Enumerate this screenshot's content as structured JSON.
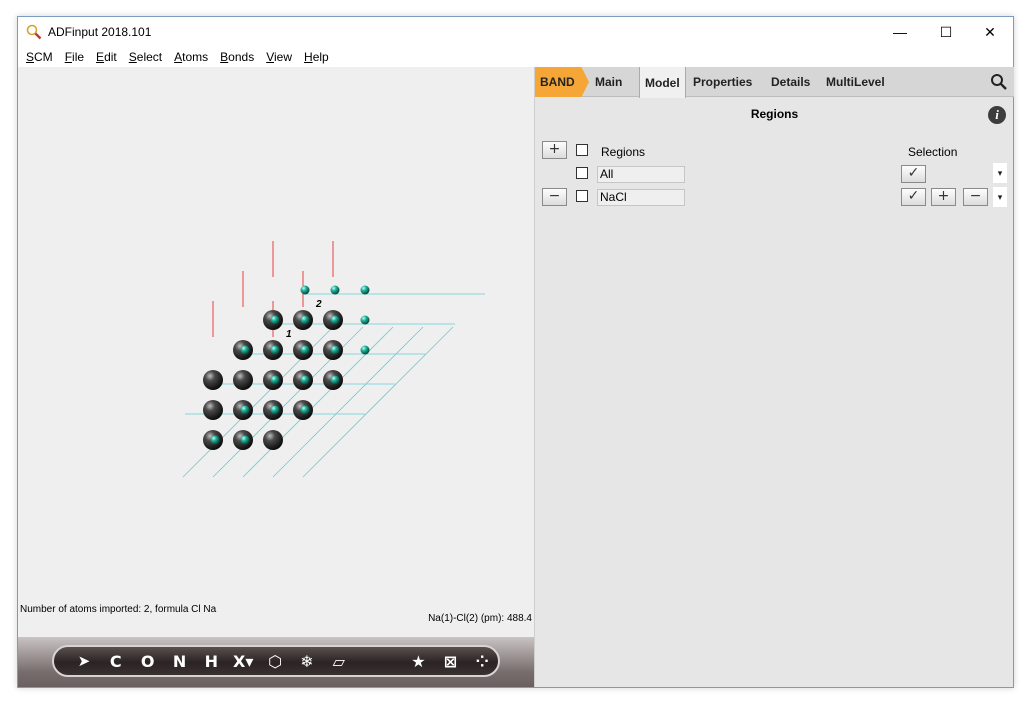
{
  "window": {
    "title": "ADFinput 2018.101",
    "controls": {
      "minimize": "—",
      "maximize": "☐",
      "close": "✕"
    }
  },
  "menu": [
    "SCM",
    "File",
    "Edit",
    "Select",
    "Atoms",
    "Bonds",
    "View",
    "Help"
  ],
  "viewer": {
    "status_left": "Number of atoms imported: 2, formula Cl Na",
    "status_right": "Na(1)-Cl(2) (pm): 488.4",
    "atom_labels": [
      "1",
      "2"
    ],
    "colors": {
      "na_atom": "#2a2a2a",
      "cl_atom": "#1fb39a",
      "cell_lines": "#63cfd6",
      "bond_red": "#e84040"
    }
  },
  "toolbar": {
    "items": [
      {
        "name": "select-tool",
        "glyph": "➤"
      },
      {
        "name": "carbon-tool",
        "glyph": "C"
      },
      {
        "name": "oxygen-tool",
        "glyph": "O"
      },
      {
        "name": "nitrogen-tool",
        "glyph": "N"
      },
      {
        "name": "hydrogen-tool",
        "glyph": "H"
      },
      {
        "name": "other-element-tool",
        "glyph": "X▾"
      },
      {
        "name": "ring-tool",
        "glyph": "⬡"
      },
      {
        "name": "snowflake-tool",
        "glyph": "❄"
      },
      {
        "name": "plane-tool",
        "glyph": "▱"
      },
      {
        "name": "favorites-tool",
        "glyph": "★"
      },
      {
        "name": "cell-tool",
        "glyph": "⊠"
      },
      {
        "name": "molecule-tool",
        "glyph": "⁘"
      }
    ]
  },
  "panel": {
    "tabs": [
      "BAND",
      "Main",
      "Model",
      "Properties",
      "Details",
      "MultiLevel"
    ],
    "active_tab": "Model",
    "section_title": "Regions",
    "info_icon": "i",
    "header": {
      "regions": "Regions",
      "selection": "Selection"
    },
    "buttons": {
      "add": "+",
      "remove": "−",
      "check": "✓",
      "sel_add": "+",
      "sel_remove": "−",
      "dropdown": "▾"
    },
    "rows": [
      {
        "name": "All"
      },
      {
        "name": "NaCl"
      }
    ],
    "colors": {
      "band_tab": "#f5a636"
    }
  }
}
